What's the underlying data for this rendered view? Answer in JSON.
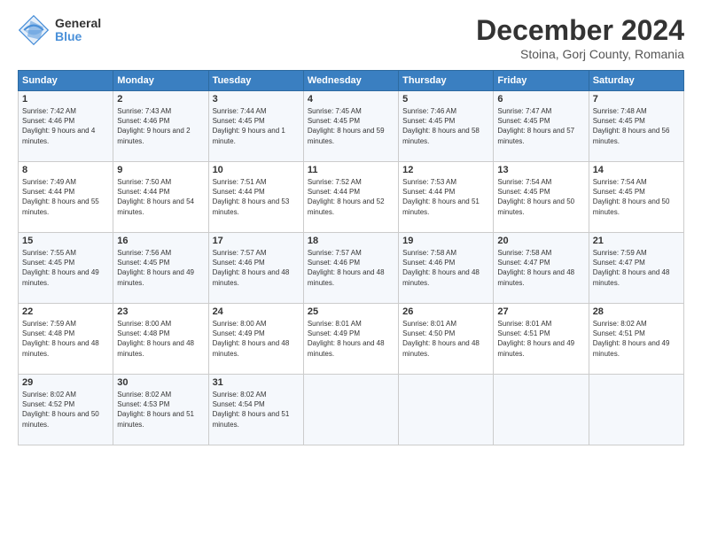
{
  "header": {
    "logo_line1": "General",
    "logo_line2": "Blue",
    "month": "December 2024",
    "location": "Stoina, Gorj County, Romania"
  },
  "days_of_week": [
    "Sunday",
    "Monday",
    "Tuesday",
    "Wednesday",
    "Thursday",
    "Friday",
    "Saturday"
  ],
  "weeks": [
    [
      {
        "day": 1,
        "sunrise": "7:42 AM",
        "sunset": "4:46 PM",
        "daylight": "9 hours and 4 minutes."
      },
      {
        "day": 2,
        "sunrise": "7:43 AM",
        "sunset": "4:46 PM",
        "daylight": "9 hours and 2 minutes."
      },
      {
        "day": 3,
        "sunrise": "7:44 AM",
        "sunset": "4:45 PM",
        "daylight": "9 hours and 1 minute."
      },
      {
        "day": 4,
        "sunrise": "7:45 AM",
        "sunset": "4:45 PM",
        "daylight": "8 hours and 59 minutes."
      },
      {
        "day": 5,
        "sunrise": "7:46 AM",
        "sunset": "4:45 PM",
        "daylight": "8 hours and 58 minutes."
      },
      {
        "day": 6,
        "sunrise": "7:47 AM",
        "sunset": "4:45 PM",
        "daylight": "8 hours and 57 minutes."
      },
      {
        "day": 7,
        "sunrise": "7:48 AM",
        "sunset": "4:45 PM",
        "daylight": "8 hours and 56 minutes."
      }
    ],
    [
      {
        "day": 8,
        "sunrise": "7:49 AM",
        "sunset": "4:44 PM",
        "daylight": "8 hours and 55 minutes."
      },
      {
        "day": 9,
        "sunrise": "7:50 AM",
        "sunset": "4:44 PM",
        "daylight": "8 hours and 54 minutes."
      },
      {
        "day": 10,
        "sunrise": "7:51 AM",
        "sunset": "4:44 PM",
        "daylight": "8 hours and 53 minutes."
      },
      {
        "day": 11,
        "sunrise": "7:52 AM",
        "sunset": "4:44 PM",
        "daylight": "8 hours and 52 minutes."
      },
      {
        "day": 12,
        "sunrise": "7:53 AM",
        "sunset": "4:44 PM",
        "daylight": "8 hours and 51 minutes."
      },
      {
        "day": 13,
        "sunrise": "7:54 AM",
        "sunset": "4:45 PM",
        "daylight": "8 hours and 50 minutes."
      },
      {
        "day": 14,
        "sunrise": "7:54 AM",
        "sunset": "4:45 PM",
        "daylight": "8 hours and 50 minutes."
      }
    ],
    [
      {
        "day": 15,
        "sunrise": "7:55 AM",
        "sunset": "4:45 PM",
        "daylight": "8 hours and 49 minutes."
      },
      {
        "day": 16,
        "sunrise": "7:56 AM",
        "sunset": "4:45 PM",
        "daylight": "8 hours and 49 minutes."
      },
      {
        "day": 17,
        "sunrise": "7:57 AM",
        "sunset": "4:46 PM",
        "daylight": "8 hours and 48 minutes."
      },
      {
        "day": 18,
        "sunrise": "7:57 AM",
        "sunset": "4:46 PM",
        "daylight": "8 hours and 48 minutes."
      },
      {
        "day": 19,
        "sunrise": "7:58 AM",
        "sunset": "4:46 PM",
        "daylight": "8 hours and 48 minutes."
      },
      {
        "day": 20,
        "sunrise": "7:58 AM",
        "sunset": "4:47 PM",
        "daylight": "8 hours and 48 minutes."
      },
      {
        "day": 21,
        "sunrise": "7:59 AM",
        "sunset": "4:47 PM",
        "daylight": "8 hours and 48 minutes."
      }
    ],
    [
      {
        "day": 22,
        "sunrise": "7:59 AM",
        "sunset": "4:48 PM",
        "daylight": "8 hours and 48 minutes."
      },
      {
        "day": 23,
        "sunrise": "8:00 AM",
        "sunset": "4:48 PM",
        "daylight": "8 hours and 48 minutes."
      },
      {
        "day": 24,
        "sunrise": "8:00 AM",
        "sunset": "4:49 PM",
        "daylight": "8 hours and 48 minutes."
      },
      {
        "day": 25,
        "sunrise": "8:01 AM",
        "sunset": "4:49 PM",
        "daylight": "8 hours and 48 minutes."
      },
      {
        "day": 26,
        "sunrise": "8:01 AM",
        "sunset": "4:50 PM",
        "daylight": "8 hours and 48 minutes."
      },
      {
        "day": 27,
        "sunrise": "8:01 AM",
        "sunset": "4:51 PM",
        "daylight": "8 hours and 49 minutes."
      },
      {
        "day": 28,
        "sunrise": "8:02 AM",
        "sunset": "4:51 PM",
        "daylight": "8 hours and 49 minutes."
      }
    ],
    [
      {
        "day": 29,
        "sunrise": "8:02 AM",
        "sunset": "4:52 PM",
        "daylight": "8 hours and 50 minutes."
      },
      {
        "day": 30,
        "sunrise": "8:02 AM",
        "sunset": "4:53 PM",
        "daylight": "8 hours and 51 minutes."
      },
      {
        "day": 31,
        "sunrise": "8:02 AM",
        "sunset": "4:54 PM",
        "daylight": "8 hours and 51 minutes."
      },
      null,
      null,
      null,
      null
    ]
  ]
}
